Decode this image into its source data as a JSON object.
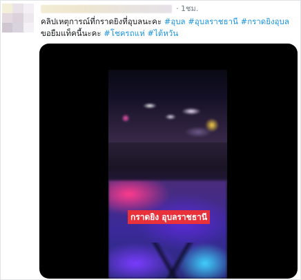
{
  "tweet": {
    "time": "· 1ชม.",
    "text_parts": [
      {
        "text": "คลิปเหตุการณ์ที่กราดยิงที่อุบลนะคะ ",
        "type": "text"
      },
      {
        "text": "#อุบล",
        "type": "hashtag"
      },
      {
        "text": " ",
        "type": "text"
      },
      {
        "text": "#อุบลราชธานี",
        "type": "hashtag"
      },
      {
        "text": " ",
        "type": "text"
      },
      {
        "text": "#กราดยิงอุบล",
        "type": "hashtag"
      },
      {
        "text": "  ขอยืมแท็คนี้นะคะ ",
        "type": "text"
      },
      {
        "text": "#โชครถแห่",
        "type": "hashtag"
      },
      {
        "text": " ",
        "type": "text"
      },
      {
        "text": "#ไต้หวัน",
        "type": "hashtag"
      }
    ]
  },
  "media": {
    "caption": "กราดยิง อุบลราชธานี"
  },
  "colors": {
    "hashtag": "#1b95e0",
    "text": "#14171a",
    "muted": "#6e7a84",
    "caption_bg": "#e8313a"
  }
}
